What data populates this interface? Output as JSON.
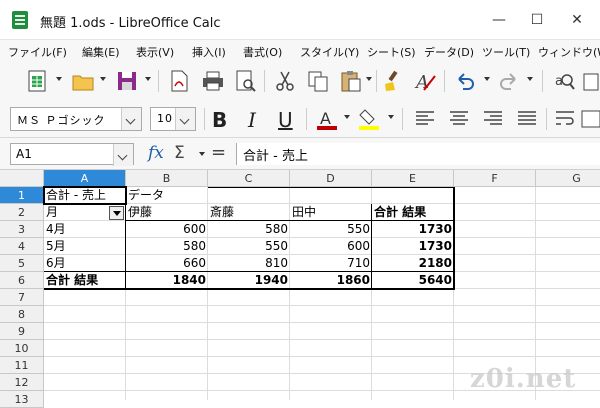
{
  "window": {
    "title": "無題 1.ods - LibreOffice Calc",
    "controls": {
      "minimize": "—",
      "maximize": "☐",
      "close": "✕"
    }
  },
  "menubar": {
    "items": [
      "ファイル(F)",
      "編集(E)",
      "表示(V)",
      "挿入(I)",
      "書式(O)",
      "スタイル(Y)",
      "シート(S)",
      "データ(D)",
      "ツール(T)",
      "ウィンドウ(W)"
    ]
  },
  "toolbar": {
    "standard_icons": [
      "new-spreadsheet-icon",
      "open-folder-icon",
      "save-icon",
      "export-pdf-icon",
      "print-icon",
      "print-preview-icon",
      "cut-icon",
      "copy-icon",
      "paste-icon",
      "clone-formatting-icon",
      "clear-formatting-icon",
      "undo-icon",
      "redo-icon",
      "find-replace-icon"
    ],
    "font_name": "ＭＳ Ｐゴシック",
    "font_size": "10",
    "format_buttons": {
      "bold": "B",
      "italic": "I",
      "underline": "U"
    },
    "font_color": "#c00000",
    "highlight_color": "#ffff00"
  },
  "formula_bar": {
    "cell_ref": "A1",
    "fx": "fx",
    "sigma": "Σ",
    "equals": "=",
    "content": "合計 - 売上"
  },
  "sheet": {
    "selected_column": "A",
    "selected_row": "1",
    "columns": [
      "A",
      "B",
      "C",
      "D",
      "E",
      "F",
      "G"
    ],
    "rows": [
      "1",
      "2",
      "3",
      "4",
      "5",
      "6",
      "7",
      "8",
      "9",
      "10",
      "11",
      "12",
      "13"
    ],
    "cells": {
      "A1": "合計 - 売上",
      "B1": "データ",
      "A2": "月",
      "B2": "伊藤",
      "C2": "斎藤",
      "D2": "田中",
      "E2": "合計 結果",
      "A3": "4月",
      "B3": "600",
      "C3": "580",
      "D3": "550",
      "E3": "1730",
      "A4": "5月",
      "B4": "580",
      "C4": "550",
      "D4": "600",
      "E4": "1730",
      "A5": "6月",
      "B5": "660",
      "C5": "810",
      "D5": "710",
      "E5": "2180",
      "A6": "合計 結果",
      "B6": "1840",
      "C6": "1940",
      "D6": "1860",
      "E6": "5640"
    }
  },
  "watermark": "z0i.net"
}
